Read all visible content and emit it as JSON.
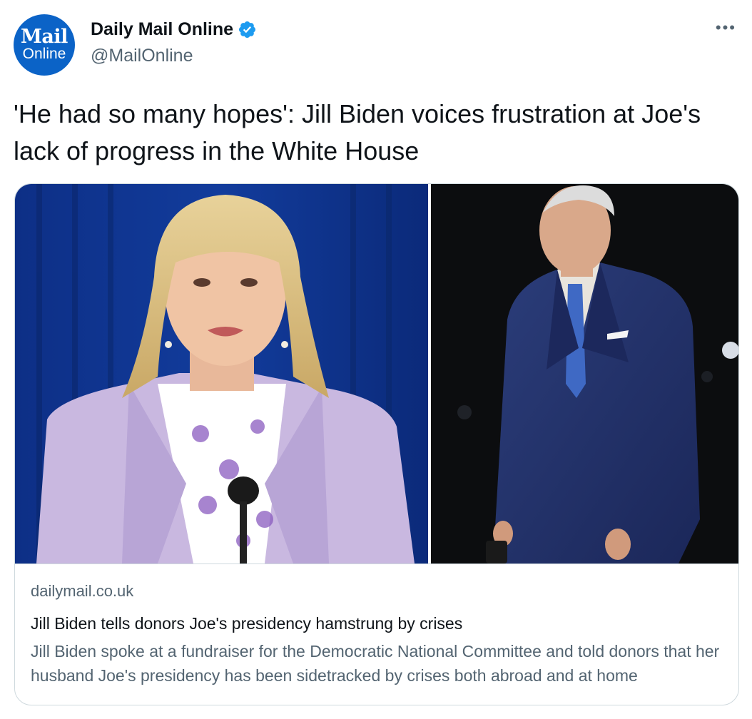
{
  "account": {
    "avatar_line1": "Mail",
    "avatar_line2": "Online",
    "display_name": "Daily Mail Online",
    "handle": "@MailOnline",
    "verified_icon": "verified-badge-icon",
    "more_icon": "more-options-icon",
    "more_glyph": "•••",
    "brand_color": "#0b63c7",
    "verified_color": "#1d9bf0"
  },
  "tweet": {
    "text": "'He had so many hopes': Jill Biden voices frustration at Joe's lack of progress in the White House"
  },
  "card": {
    "domain": "dailymail.co.uk",
    "title": "Jill Biden tells donors Joe's presidency hamstrung by crises",
    "description": "Jill Biden spoke at a fundraiser for the Democratic National Committee and told donors that her husband Joe's presidency has been sidetracked by crises both abroad and at home"
  }
}
